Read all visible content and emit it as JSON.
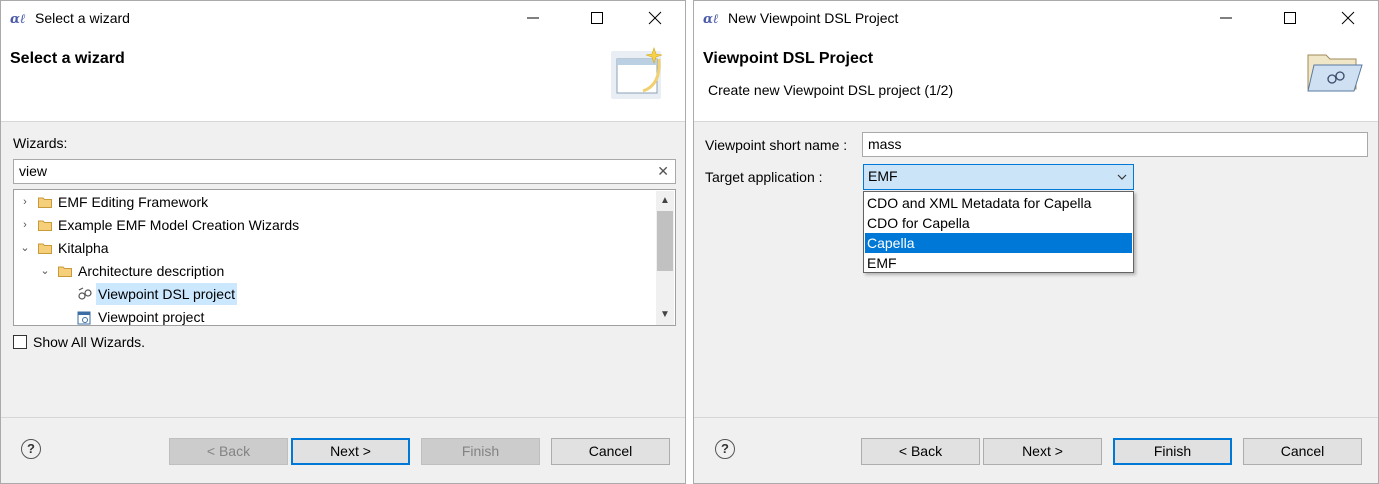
{
  "left_window": {
    "title": "Select a wizard",
    "header_title": "Select a wizard",
    "wizards_label": "Wizards:",
    "filter_value": "view",
    "tree": [
      {
        "label": "EMF Editing Framework",
        "expanded": false
      },
      {
        "label": "Example EMF Model Creation Wizards",
        "expanded": false
      },
      {
        "label": "Kitalpha",
        "expanded": true
      },
      {
        "label": "Architecture description",
        "expanded": true
      },
      {
        "label": "Viewpoint DSL project",
        "selected": true
      },
      {
        "label": "Viewpoint project"
      }
    ],
    "show_all_label": "Show All Wizards.",
    "buttons": {
      "back": "< Back",
      "next": "Next >",
      "finish": "Finish",
      "cancel": "Cancel"
    }
  },
  "right_window": {
    "title": "New Viewpoint DSL Project",
    "header_title": "Viewpoint DSL Project",
    "header_subtitle": "Create new Viewpoint DSL project (1/2)",
    "short_name_label": "Viewpoint short name :",
    "short_name_value": "mass",
    "target_label": "Target application :",
    "target_value": "EMF",
    "target_options": [
      "CDO and XML Metadata for Capella",
      "CDO for Capella",
      "Capella",
      "EMF"
    ],
    "highlighted_option": "Capella",
    "buttons": {
      "back": "< Back",
      "next": "Next >",
      "finish": "Finish",
      "cancel": "Cancel"
    }
  },
  "colors": {
    "selection": "#0078d7",
    "tree_selection": "#cce8ff",
    "combo_bg": "#cce4f7"
  }
}
